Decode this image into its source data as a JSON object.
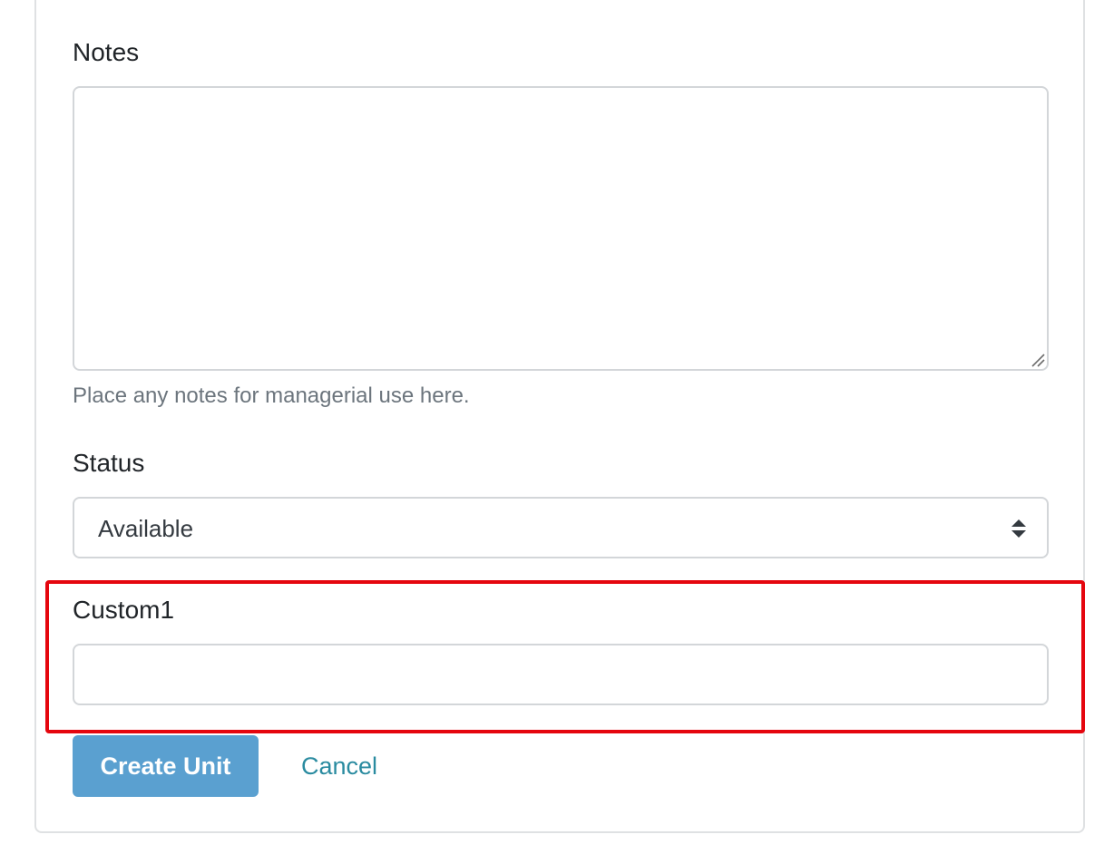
{
  "form": {
    "notes": {
      "label": "Notes",
      "value": "",
      "help_text": "Place any notes for managerial use here."
    },
    "status": {
      "label": "Status",
      "selected": "Available"
    },
    "custom1": {
      "label": "Custom1",
      "value": ""
    },
    "actions": {
      "submit_label": "Create Unit",
      "cancel_label": "Cancel"
    }
  },
  "colors": {
    "primary_button": "#5aa0d0",
    "link": "#2a8ba0",
    "highlight": "#e5060e",
    "help_text": "#6c757d"
  },
  "icons": {
    "resize": "resize-grip-icon",
    "select": "sort-arrows-icon"
  }
}
